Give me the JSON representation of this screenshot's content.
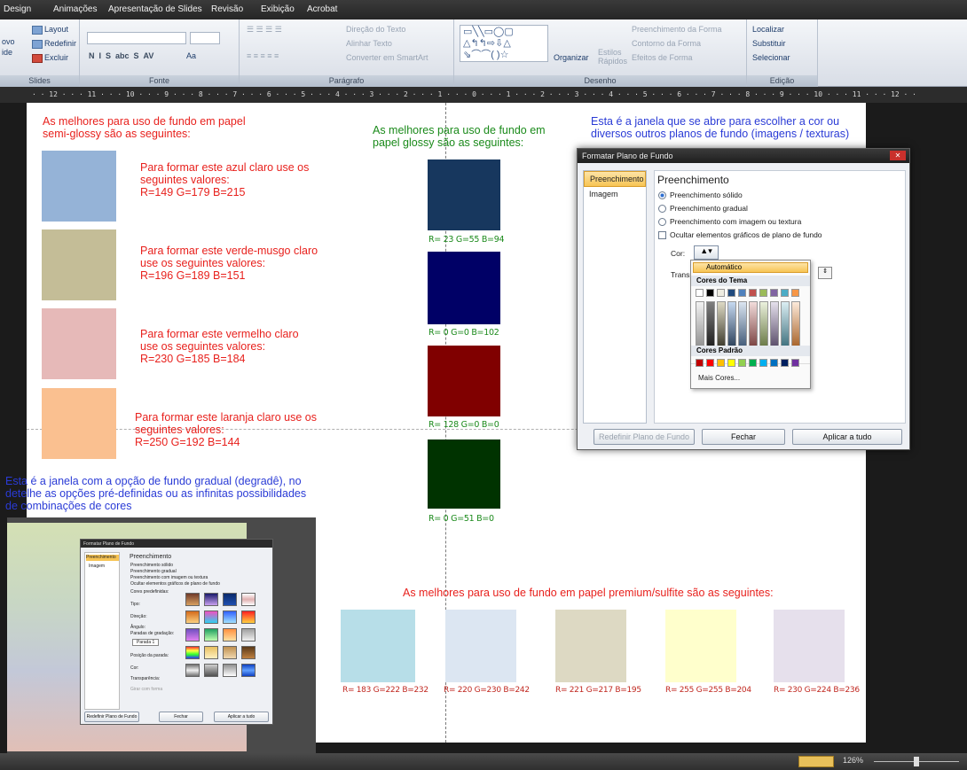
{
  "menubar": {
    "items": [
      "Design",
      "Animações",
      "Apresentação de Slides",
      "Revisão",
      "Exibição",
      "Acrobat"
    ]
  },
  "ribbon": {
    "slides": {
      "layout": "Layout",
      "redefinir": "Redefinir",
      "excluir": "Excluir",
      "novo": "ovo",
      "novo2": "ide",
      "group": "Slides"
    },
    "fonte": {
      "group": "Fonte",
      "aa": "Aa"
    },
    "paragrafo": {
      "direcao": "Direção do Texto",
      "alinhar": "Alinhar Texto",
      "converter": "Converter em SmartArt",
      "group": "Parágrafo"
    },
    "desenho": {
      "organizar": "Organizar",
      "estilos": "Estilos",
      "rapidos": "Rápidos",
      "preenchimento": "Preenchimento da Forma",
      "contorno": "Contorno da Forma",
      "efeitos": "Efeitos de Forma",
      "group": "Desenho"
    },
    "edicao": {
      "localizar": "Localizar",
      "substituir": "Substituir",
      "selecionar": "Selecionar",
      "group": "Edição"
    }
  },
  "ruler": "· · 12 · · · 11 · · · 10 · · · 9 · · · 8 · · · 7 · · · 6 · · · 5 · · · 4 · · · 3 · · · 2 · · · 1 · · · 0 · · · 1 · · · 2 · · · 3 · · · 4 · · · 5 · · · 6 · · · 7 · · · 8 · · · 9 · · · 10 · · · 11 · · · 12 · ·",
  "slide": {
    "semi_title": "As melhores para uso de fundo em papel semi-glossy são as seguintes:",
    "semi": [
      {
        "color": "#95B3D7",
        "text1": "Para formar este azul claro use os",
        "text2": "seguintes valores:",
        "text3": "R=149 G=179 B=215"
      },
      {
        "color": "#C4BD97",
        "text1": "Para formar este verde-musgo claro",
        "text2": "use os seguintes valores:",
        "text3": "R=196 G=189 B=151"
      },
      {
        "color": "#E6B9B8",
        "text1": "Para formar este vermelho claro",
        "text2": "use os seguintes valores:",
        "text3": "R=230 G=185 B=184"
      },
      {
        "color": "#FAC090",
        "text1": "Para formar este laranja claro use os",
        "text2": "seguintes valores:",
        "text3": "R=250 G=192 B=144"
      }
    ],
    "glossy_title": "As melhores para uso de fundo em papel glossy são as seguintes:",
    "glossy": [
      {
        "color": "#17375E",
        "label": "R= 23 G=55 B=94"
      },
      {
        "color": "#000066",
        "label": "R= 0 G=0 B=102"
      },
      {
        "color": "#800000",
        "label": "R= 128 G=0 B=0"
      },
      {
        "color": "#003300",
        "label": "R= 0 G=51 B=0"
      }
    ],
    "janela_title": "Esta é a janela que se abre para escolher a cor ou diversos outros planos de fundo (imagens / texturas)",
    "gradual_title": "Esta é a janela com a opção de fundo gradual (degradê), no detelhe as opções pré-definidas ou as infinitas possibilidades de combinações de cores",
    "premium_title": "As melhores para uso de fundo em papel premium/sulfite são as seguintes:",
    "premium": [
      {
        "color": "#B7DEE8",
        "label": "R= 183 G=222 B=232"
      },
      {
        "color": "#DCE6F2",
        "label": "R= 220 G=230 B=242"
      },
      {
        "color": "#DDD9C3",
        "label": "R= 221 G=217 B=195"
      },
      {
        "color": "#FFFFCC",
        "label": "R= 255 G=255 B=204"
      },
      {
        "color": "#E6E0EC",
        "label": "R= 230 G=224 B=236"
      }
    ]
  },
  "dialog": {
    "title": "Formatar Plano de Fundo",
    "tab_preenchimento": "Preenchimento",
    "tab_imagem": "Imagem",
    "heading": "Preenchimento",
    "opt1": "Preenchimento sólido",
    "opt2": "Preenchimento gradual",
    "opt3": "Preenchimento com imagem ou textura",
    "chk": "Ocultar elementos gráficos de plano de fundo",
    "cor": "Cor:",
    "transp": "Transp",
    "automatico": "Automático",
    "cores_tema": "Cores do Tema",
    "cores_padrao": "Cores Padrão",
    "mais": "Mais Cores...",
    "btn_redefinir": "Redefinir Plano de Fundo",
    "btn_fechar": "Fechar",
    "btn_aplicar": "Aplicar a tudo"
  },
  "small_dialog": {
    "title": "Formatar Plano de Fundo",
    "tab1": "Preenchimento",
    "tab2": "Imagem",
    "heading": "Preenchimento",
    "o1": "Preenchimento sólido",
    "o2": "Preenchimento gradual",
    "o3": "Preenchimento com imagem ou textura",
    "o4": "Ocultar elementos gráficos de plano de fundo",
    "cores_pre": "Cores predefinidas:",
    "tipo": "Tipo:",
    "direcao": "Direção:",
    "angulo": "Ângulo:",
    "paradas": "Paradas de gradação:",
    "parada": "Parada 1",
    "posicao": "Posição da parada:",
    "cor": "Cor:",
    "transparencia": "Transparência:",
    "girar": "Girar com forma",
    "b1": "Redefinir Plano de Fundo",
    "b2": "Fechar",
    "b3": "Aplicar a tudo"
  },
  "status": {
    "zoom": "126%"
  }
}
